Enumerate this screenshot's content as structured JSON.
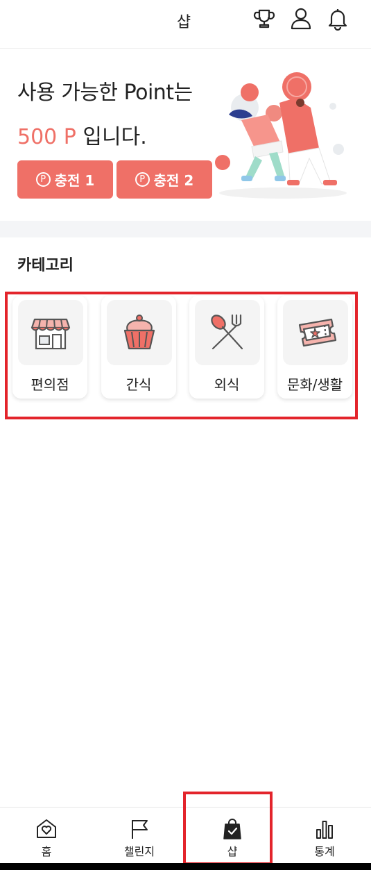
{
  "header": {
    "title": "샵",
    "icons": [
      "trophy-icon",
      "profile-icon",
      "bell-icon"
    ]
  },
  "points": {
    "line1": "사용 가능한 Point는",
    "value": "500 P",
    "suffix": " 입니다.",
    "charge_buttons": [
      {
        "symbol": "P",
        "label": "충전 1"
      },
      {
        "symbol": "P",
        "label": "충전 2"
      }
    ]
  },
  "categories": {
    "title": "카테고리",
    "items": [
      {
        "label": "편의점",
        "icon": "store-icon"
      },
      {
        "label": "간식",
        "icon": "cupcake-icon"
      },
      {
        "label": "외식",
        "icon": "fork-spoon-icon"
      },
      {
        "label": "문화/생활",
        "icon": "ticket-icon"
      }
    ]
  },
  "bottom_nav": {
    "items": [
      {
        "label": "홈",
        "icon": "home-heart-icon"
      },
      {
        "label": "챌린지",
        "icon": "flag-icon"
      },
      {
        "label": "샵",
        "icon": "shopping-bag-icon",
        "active": true
      },
      {
        "label": "통계",
        "icon": "bar-chart-icon"
      }
    ]
  },
  "colors": {
    "accent": "#ef7067",
    "highlight": "#e3242b",
    "divider": "#f4f5f7"
  }
}
